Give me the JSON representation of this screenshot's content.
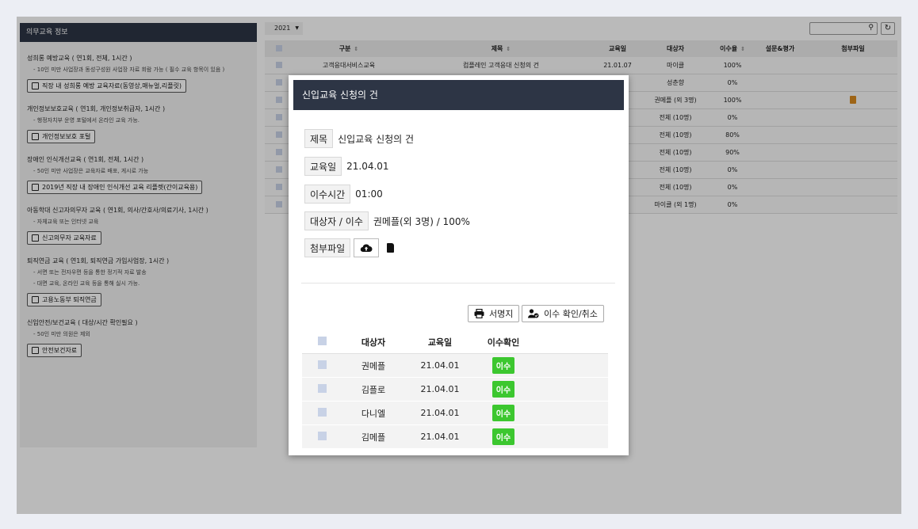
{
  "left_panel": {
    "header": "의무교육 정보",
    "sections": [
      {
        "title": "성희롱 예방교육 ( 연1회, 전체, 1시간 )",
        "desc": [
          "- 10인 미만 사업장과 동성구성원 사업장 자료 회람 가능 ( 필수 교육 항목이 있음 )"
        ],
        "button": "직장 내 성희롱 예방 교육자료(동영상,매뉴얼,리플릿)"
      },
      {
        "title": "개인정보보호교육 ( 연1회, 개인정보취급자, 1시간 )",
        "desc": [
          "- 행정자치부 운영 포털에서 온라인 교육 가능."
        ],
        "button": "개인정보보호 포털"
      },
      {
        "title": "장애인 인식개선교육 ( 연1회, 전체, 1시간 )",
        "desc": [
          "- 50인 미만 사업장은 교육자료 배포, 게시로 가능"
        ],
        "button": "2019년 직장 내 장애인 인식개선 교육 리플렛(간이교육용)"
      },
      {
        "title": "아동학대 신고자의무자 교육 ( 연1회, 의사/간호사/의료기사, 1시간 )",
        "desc": [
          "- 자체교육 또는 인터넷 교육"
        ],
        "button": "신고의무자 교육자료"
      },
      {
        "title": "퇴직연금 교육 ( 연1회, 퇴직연금 가입사업장, 1시간 )",
        "desc": [
          "- 서면 또는 전자우편 등을 통한 정기적 자료 발송",
          "- 대면 교육, 온라인 교육 등을 통해 실시 가능."
        ],
        "button": "고용노동부 퇴직연금"
      },
      {
        "title": "신입안전/보건교육 ( 대상/시간 확인필요 )",
        "desc": [
          "- 50인 미만 의원은 제외"
        ],
        "button": "안전보건자료"
      }
    ]
  },
  "toolbar": {
    "year": "2021"
  },
  "table": {
    "headers": {
      "category": "구분",
      "title": "제목",
      "date": "교육일",
      "target": "대상자",
      "rate": "이수율",
      "survey": "설문&평가",
      "attachment": "첨부파일"
    },
    "rows": [
      {
        "category": "고객응대서비스교육",
        "title": "컴플레인 고객응대 신청의 건",
        "date": "21.01.07",
        "target": "마이클",
        "rate": "100%"
      },
      {
        "category": "",
        "title": "",
        "date": "",
        "target": "성춘향",
        "rate": "0%"
      },
      {
        "category": "",
        "title": "",
        "date": "",
        "target": "권메플 (외 3명)",
        "rate": "100%"
      },
      {
        "category": "",
        "title": "",
        "date": "",
        "target": "전체 (10명)",
        "rate": "0%"
      },
      {
        "category": "",
        "title": "",
        "date": "",
        "target": "전체 (10명)",
        "rate": "80%"
      },
      {
        "category": "",
        "title": "",
        "date": "",
        "target": "전체 (10명)",
        "rate": "90%"
      },
      {
        "category": "",
        "title": "",
        "date": "",
        "target": "전체 (10명)",
        "rate": "0%"
      },
      {
        "category": "",
        "title": "",
        "date": "",
        "target": "전체 (10명)",
        "rate": "0%"
      },
      {
        "category": "",
        "title": "",
        "date": "",
        "target": "마이클 (외 1명)",
        "rate": "0%"
      }
    ]
  },
  "modal": {
    "title": "신입교육 신청의 건",
    "fields": {
      "subject_label": "제목",
      "subject_value": "신입교육 신청의 건",
      "date_label": "교육일",
      "date_value": "21.04.01",
      "time_label": "이수시간",
      "time_value": "01:00",
      "target_label": "대상자 / 이수",
      "target_value": "권메플(외 3명) / 100%",
      "file_label": "첨부파일"
    },
    "buttons": {
      "sign": "서명지",
      "confirm": "이수 확인/취소"
    },
    "table_headers": {
      "target": "대상자",
      "date": "교육일",
      "confirm": "이수확인"
    },
    "rows": [
      {
        "name": "권메플",
        "date": "21.04.01",
        "status": "이수"
      },
      {
        "name": "김플로",
        "date": "21.04.01",
        "status": "이수"
      },
      {
        "name": "다니엘",
        "date": "21.04.01",
        "status": "이수"
      },
      {
        "name": "김메플",
        "date": "21.04.01",
        "status": "이수"
      }
    ]
  }
}
